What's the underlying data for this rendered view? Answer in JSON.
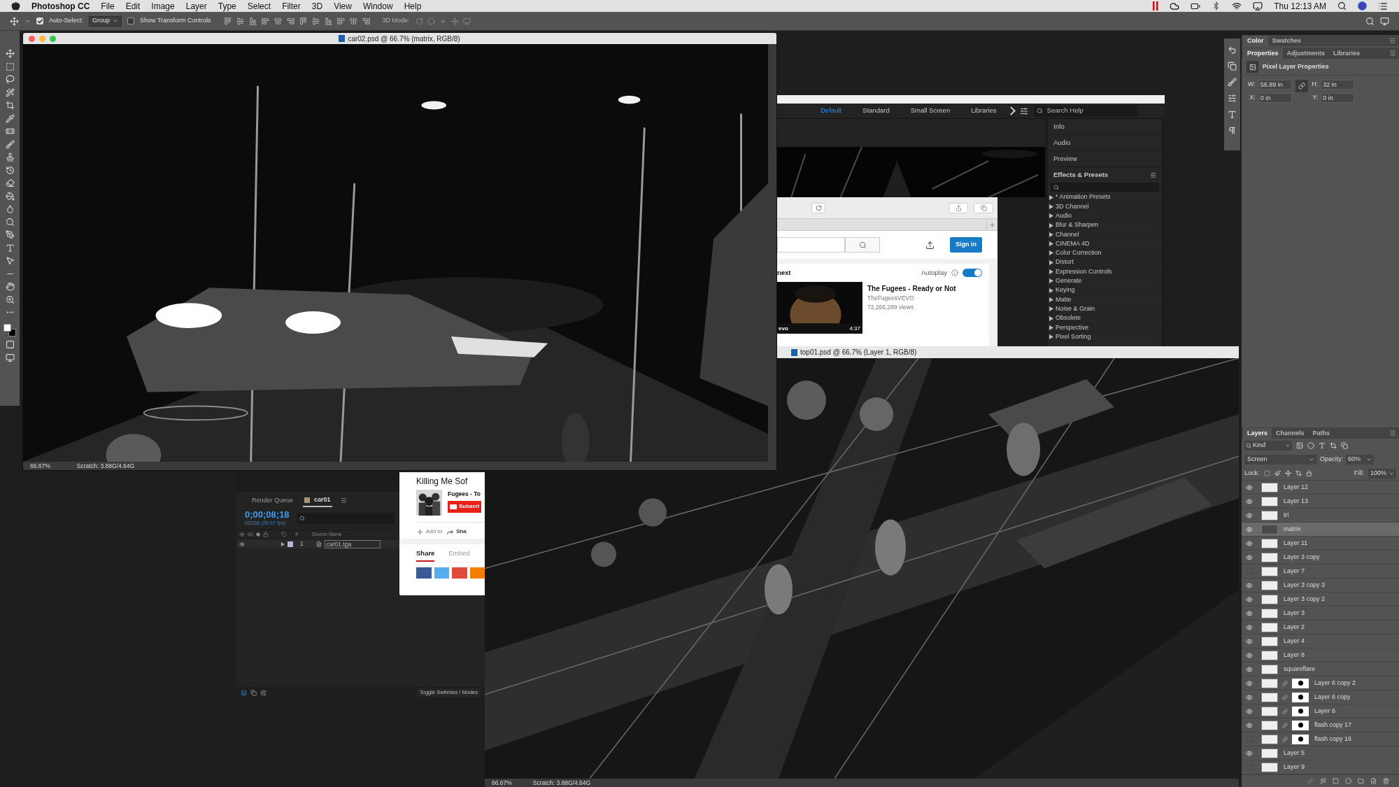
{
  "menubar": {
    "app": "Photoshop CC",
    "menus": [
      "File",
      "Edit",
      "Image",
      "Layer",
      "Type",
      "Select",
      "Filter",
      "3D",
      "View",
      "Window",
      "Help"
    ],
    "clock": "Thu 12:13 AM"
  },
  "options_bar": {
    "auto_select": {
      "label": "Auto-Select:",
      "checked": true
    },
    "group_value": "Group",
    "transform_controls": {
      "label": "Show Transform Controls",
      "checked": false
    },
    "mode_3d": "3D Mode:"
  },
  "document_windows": [
    {
      "title": "car02.psd @ 66.7% (matrix, RGB/8)",
      "zoom": "66.67%",
      "scratch": "Scratch: 3.88G/4.64G"
    },
    {
      "title": "top01.psd @ 66.7% (Layer 1, RGB/8)",
      "zoom": "66.67%",
      "scratch": "Scratch: 3.88G/4.64G"
    }
  ],
  "after_effects": {
    "workspaces": [
      {
        "label": "Default",
        "selected": true
      },
      {
        "label": "Standard",
        "selected": false
      },
      {
        "label": "Small Screen",
        "selected": false
      },
      {
        "label": "Libraries",
        "selected": false
      }
    ],
    "search_placeholder": "Search Help",
    "panels": [
      "Info",
      "Audio",
      "Preview"
    ],
    "effects_title": "Effects & Presets",
    "effects": [
      "* Animation Presets",
      "3D Channel",
      "Audio",
      "Blur & Sharpen",
      "Channel",
      "CINEMA 4D",
      "Color Correction",
      "Distort",
      "Expression Controls",
      "Generate",
      "Keying",
      "Matte",
      "Noise & Grain",
      "Obsolete",
      "Perspective",
      "Pixel Sorting"
    ]
  },
  "browser": {
    "sign_in": "Sign in",
    "up_next": "next",
    "autoplay": {
      "label": "Autoplay",
      "on": true
    },
    "video": {
      "title": "The Fugees - Ready or Not",
      "channel": "TheFugeesVEVO",
      "views": "72,266,289 views",
      "duration": "4:37",
      "badge": "evo"
    },
    "page_title": "Killing Me Sof",
    "channel": "Fugees - To",
    "subscribe": "Subscri",
    "add_to": "Add to",
    "share_action": "Sha",
    "tabs": [
      {
        "label": "Share",
        "selected": true
      },
      {
        "label": "Embed",
        "selected": false
      }
    ]
  },
  "timeline": {
    "tabs": [
      {
        "label": "Render Queue",
        "selected": false
      },
      {
        "label": "car01",
        "selected": true
      }
    ],
    "timecode": "0;00;08;18",
    "frames": "00258 (29.97 fps)",
    "columns": [
      "#",
      "Source Name"
    ],
    "layers": [
      {
        "number": "1",
        "name": "car01.tga"
      }
    ],
    "toggle": "Toggle Switches / Modes"
  },
  "color_panel": {
    "tabs": [
      {
        "label": "Color",
        "selected": true
      },
      {
        "label": "Swatches",
        "selected": false
      }
    ]
  },
  "properties_panel": {
    "tabs": [
      {
        "label": "Properties",
        "selected": true
      },
      {
        "label": "Adjustments",
        "selected": false
      },
      {
        "label": "Libraries",
        "selected": false
      }
    ],
    "title": "Pixel Layer Properties",
    "fields": [
      {
        "label": "W:",
        "value": "56.89 in"
      },
      {
        "label": "H:",
        "value": "32 in"
      },
      {
        "label": "X:",
        "value": "0 in"
      },
      {
        "label": "Y:",
        "value": "0 in"
      }
    ]
  },
  "layers_panel": {
    "tabs": [
      {
        "label": "Layers",
        "selected": true
      },
      {
        "label": "Channels",
        "selected": false
      },
      {
        "label": "Paths",
        "selected": false
      }
    ],
    "filter": "Kind",
    "blend_mode": "Screen",
    "opacity_label": "Opacity:",
    "opacity": "60%",
    "lock_label": "Lock:",
    "fill_label": "Fill:",
    "fill": "100%",
    "layers": [
      {
        "name": "Layer 12",
        "visible": true,
        "selected": false,
        "kind": "plain"
      },
      {
        "name": "Layer 13",
        "visible": true,
        "selected": false,
        "kind": "plain"
      },
      {
        "name": "tri",
        "visible": true,
        "selected": false,
        "kind": "plain"
      },
      {
        "name": "matrix",
        "visible": true,
        "selected": true,
        "kind": "plain"
      },
      {
        "name": "Layer 11",
        "visible": true,
        "selected": false,
        "kind": "plain"
      },
      {
        "name": "Layer 3 copy",
        "visible": true,
        "selected": false,
        "kind": "plain"
      },
      {
        "name": "Layer 7",
        "visible": false,
        "selected": false,
        "kind": "plain"
      },
      {
        "name": "Layer 3 copy 3",
        "visible": true,
        "selected": false,
        "kind": "plain"
      },
      {
        "name": "Layer 3 copy 2",
        "visible": true,
        "selected": false,
        "kind": "plain"
      },
      {
        "name": "Layer 3",
        "visible": true,
        "selected": false,
        "kind": "plain"
      },
      {
        "name": "Layer 2",
        "visible": true,
        "selected": false,
        "kind": "plain"
      },
      {
        "name": "Layer 4",
        "visible": true,
        "selected": false,
        "kind": "plain"
      },
      {
        "name": "Layer 8",
        "visible": true,
        "selected": false,
        "kind": "plain"
      },
      {
        "name": "squareflare",
        "visible": true,
        "selected": false,
        "kind": "plain"
      },
      {
        "name": "Layer 6 copy 2",
        "visible": true,
        "selected": false,
        "kind": "masked"
      },
      {
        "name": "Layer 6 copy",
        "visible": true,
        "selected": false,
        "kind": "masked"
      },
      {
        "name": "Layer 6",
        "visible": true,
        "selected": false,
        "kind": "masked"
      },
      {
        "name": "flash copy 17",
        "visible": true,
        "selected": false,
        "kind": "masked"
      },
      {
        "name": "flash copy 16",
        "visible": false,
        "selected": false,
        "kind": "masked"
      },
      {
        "name": "Layer 5",
        "visible": true,
        "selected": false,
        "kind": "plain"
      },
      {
        "name": "Layer 9",
        "visible": false,
        "selected": false,
        "kind": "plain"
      }
    ]
  }
}
